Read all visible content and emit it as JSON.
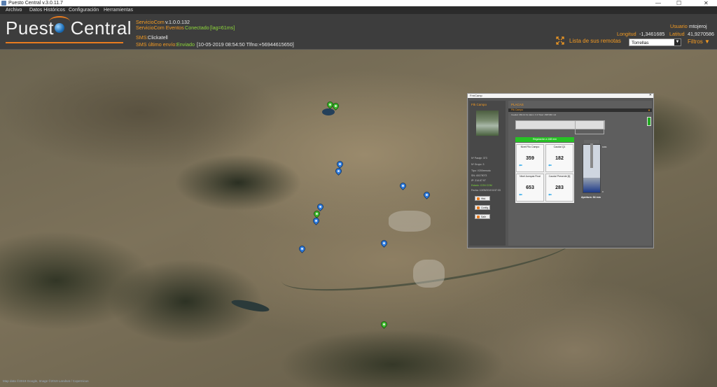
{
  "window": {
    "title": "Puesto Central v.3.0.11.7"
  },
  "menu": {
    "items": [
      "Archivo",
      "Datos Históricos",
      "Configuración",
      "Herramientas"
    ]
  },
  "header": {
    "logo_left": "Puest",
    "logo_right": "Central",
    "servicio_label": "ServicioCom",
    "servicio_version": "v.1.0.0.132",
    "eventos_label": "ServicioCom Eventos",
    "eventos_status": "Conectado",
    "eventos_lag": "[lag=61ms]",
    "sms_label": "SMS:",
    "sms_value": "Clickatell",
    "sms_last_label": "SMS último envío:",
    "sms_last_status": "Enviado",
    "sms_last_detail": "[10-05-2019 08:54:50  Tlfno:+56944615650]",
    "usuario_label": "Usuario",
    "usuario_value": "mtojeroj",
    "longitud_label": "Longitud",
    "longitud_value": "-1,3461685",
    "latitud_label": "Latitud",
    "latitud_value": "41,9270586",
    "remotas_label": "Lista de sus remotas",
    "select_value": "Torrellas",
    "filtros_label": "Filtros"
  },
  "map": {
    "attribution": "Map data ©2019 Google, Image ©2019 Landsat / Copernicus",
    "pin_colors": {
      "blue": "#2f7de0",
      "green": "#3dbb2a"
    }
  },
  "popup": {
    "title": "FrmCamp",
    "left_title": "Ftk Campo",
    "info": [
      "Nº Paraje: 373",
      "Nº Grupo: 3",
      "Tipo: V200remoto",
      "SN: 40179073",
      "IP: 214.67.97",
      "Estado: CON COM",
      "Fecha: 10/05/2019 8:57:33"
    ],
    "buttons": [
      "Hist.",
      "Config.",
      "Salir"
    ],
    "right_title": "PLACAS",
    "bar_text": "Ftk Campo",
    "sub_text": "Caudal: 363.10 l/s  Alarm: 0.0   Total: 1587366 m3",
    "banner": "Regulación a 168 mm",
    "cards": [
      {
        "title": "Nivel Filo Campo",
        "value": "359"
      },
      {
        "title": "Caudal Q1",
        "value": "182"
      },
      {
        "title": "Nivel Acequia Final",
        "value": "653"
      },
      {
        "title": "Caudal Presente [lt]",
        "value": "283"
      }
    ],
    "tank_label": "Apertura: 84 mm",
    "tank_marks": [
      "1001",
      "0"
    ]
  }
}
